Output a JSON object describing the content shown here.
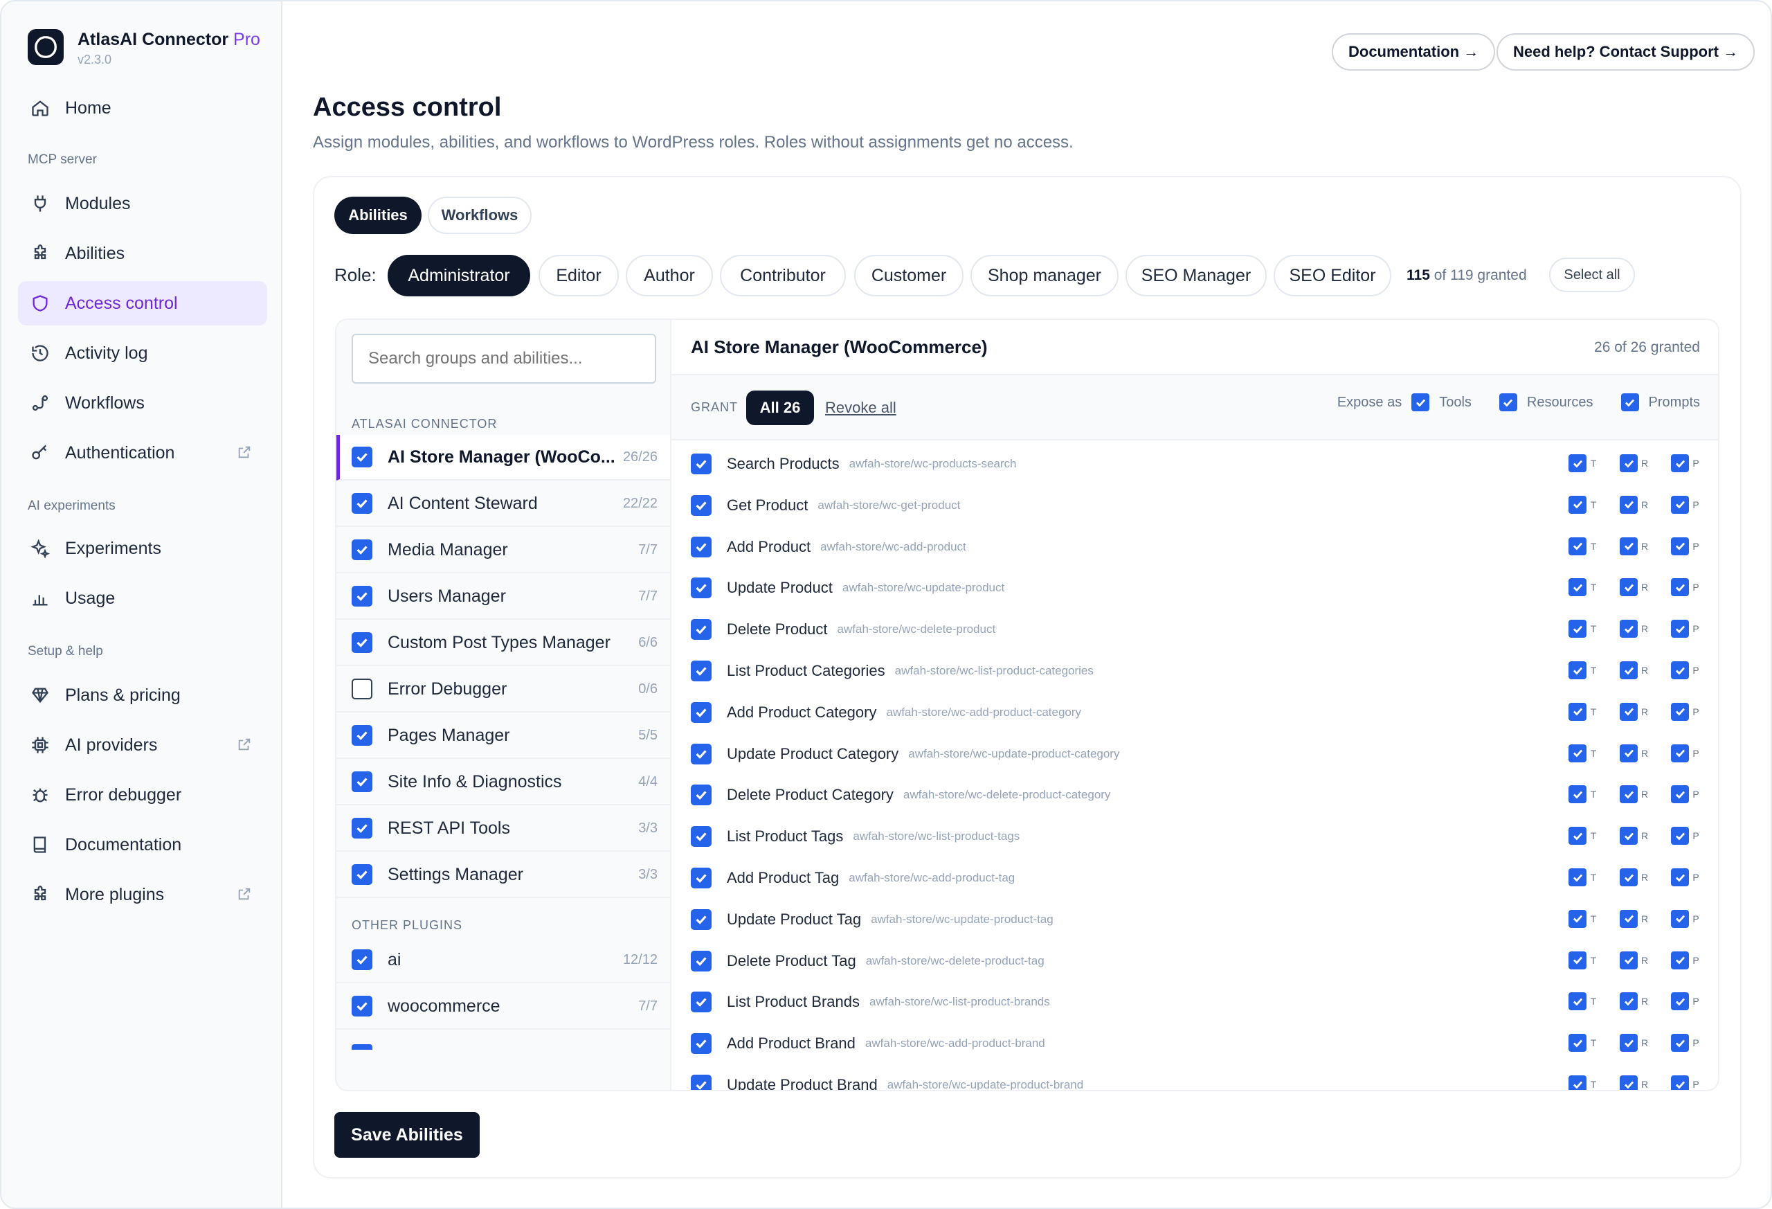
{
  "app": {
    "name": "AtlasAI Connector",
    "tier": "Pro",
    "version": "v2.3.0"
  },
  "sidebar": {
    "home": "Home",
    "section_mcp": "MCP server",
    "modules": "Modules",
    "abilities": "Abilities",
    "access_control": "Access control",
    "activity_log": "Activity log",
    "workflows": "Workflows",
    "authentication": "Authentication",
    "section_ai": "AI experiments",
    "experiments": "Experiments",
    "usage": "Usage",
    "section_setup": "Setup & help",
    "plans": "Plans & pricing",
    "ai_providers": "AI providers",
    "error_debugger": "Error debugger",
    "documentation": "Documentation",
    "more_plugins": "More plugins"
  },
  "header": {
    "docs_button": "Documentation →",
    "support_button": "Need help? Contact Support →",
    "title": "Access control",
    "subtitle": "Assign modules, abilities, and workflows to WordPress roles. Roles without assignments get no access."
  },
  "tabs": {
    "abilities": "Abilities",
    "workflows": "Workflows"
  },
  "roles": {
    "label": "Role:",
    "items": [
      "Administrator",
      "Editor",
      "Author",
      "Contributor",
      "Customer",
      "Shop manager",
      "SEO Manager",
      "SEO Editor"
    ],
    "granted_count": "115",
    "granted_suffix": "of 119 granted",
    "select_all": "Select all"
  },
  "groups": {
    "search_placeholder": "Search groups and abilities...",
    "section_connector": "ATLASAI CONNECTOR",
    "connector": [
      {
        "name": "AI Store Manager (WooCo...",
        "count": "26/26",
        "checked": true
      },
      {
        "name": "AI Content Steward",
        "count": "22/22",
        "checked": true
      },
      {
        "name": "Media Manager",
        "count": "7/7",
        "checked": true
      },
      {
        "name": "Users Manager",
        "count": "7/7",
        "checked": true
      },
      {
        "name": "Custom Post Types Manager",
        "count": "6/6",
        "checked": true
      },
      {
        "name": "Error Debugger",
        "count": "0/6",
        "checked": false
      },
      {
        "name": "Pages Manager",
        "count": "5/5",
        "checked": true
      },
      {
        "name": "Site Info & Diagnostics",
        "count": "4/4",
        "checked": true
      },
      {
        "name": "REST API Tools",
        "count": "3/3",
        "checked": true
      },
      {
        "name": "Settings Manager",
        "count": "3/3",
        "checked": true
      }
    ],
    "section_other": "OTHER PLUGINS",
    "other": [
      {
        "name": "ai",
        "count": "12/12",
        "checked": true
      },
      {
        "name": "woocommerce",
        "count": "7/7",
        "checked": true
      }
    ]
  },
  "detail": {
    "title": "AI Store Manager (WooCommerce)",
    "granted": "26 of 26 granted",
    "grant_label": "GRANT",
    "all_button": "All 26",
    "revoke": "Revoke all",
    "expose_label": "Expose as",
    "expose_tools": "Tools",
    "expose_resources": "Resources",
    "expose_prompts": "Prompts",
    "letters": {
      "t": "T",
      "r": "R",
      "p": "P"
    },
    "abilities": [
      {
        "name": "Search Products",
        "slug": "awfah-store/wc-products-search"
      },
      {
        "name": "Get Product",
        "slug": "awfah-store/wc-get-product"
      },
      {
        "name": "Add Product",
        "slug": "awfah-store/wc-add-product"
      },
      {
        "name": "Update Product",
        "slug": "awfah-store/wc-update-product"
      },
      {
        "name": "Delete Product",
        "slug": "awfah-store/wc-delete-product"
      },
      {
        "name": "List Product Categories",
        "slug": "awfah-store/wc-list-product-categories"
      },
      {
        "name": "Add Product Category",
        "slug": "awfah-store/wc-add-product-category"
      },
      {
        "name": "Update Product Category",
        "slug": "awfah-store/wc-update-product-category"
      },
      {
        "name": "Delete Product Category",
        "slug": "awfah-store/wc-delete-product-category"
      },
      {
        "name": "List Product Tags",
        "slug": "awfah-store/wc-list-product-tags"
      },
      {
        "name": "Add Product Tag",
        "slug": "awfah-store/wc-add-product-tag"
      },
      {
        "name": "Update Product Tag",
        "slug": "awfah-store/wc-update-product-tag"
      },
      {
        "name": "Delete Product Tag",
        "slug": "awfah-store/wc-delete-product-tag"
      },
      {
        "name": "List Product Brands",
        "slug": "awfah-store/wc-list-product-brands"
      },
      {
        "name": "Add Product Brand",
        "slug": "awfah-store/wc-add-product-brand"
      },
      {
        "name": "Update Product Brand",
        "slug": "awfah-store/wc-update-product-brand"
      }
    ]
  },
  "save_button": "Save Abilities",
  "colors": {
    "accent": "#6d28d9",
    "checkbox": "#2563eb",
    "dark": "#0f172a"
  }
}
